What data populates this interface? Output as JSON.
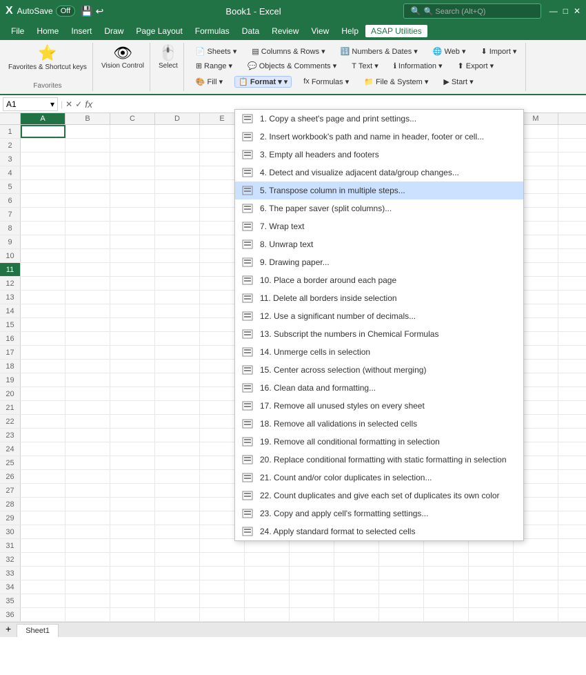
{
  "titlebar": {
    "logo": "X",
    "autosave_label": "AutoSave",
    "autosave_state": "Off",
    "save_icon": "💾",
    "title": "Book1  -  Excel",
    "search_placeholder": "🔍 Search (Alt+Q)"
  },
  "menubar": {
    "items": [
      "File",
      "Home",
      "Insert",
      "Draw",
      "Page Layout",
      "Formulas",
      "Data",
      "Review",
      "View",
      "Help",
      "ASAP Utilities"
    ]
  },
  "ribbon": {
    "favorites_label": "Favorites & Shortcut keys",
    "favorites_group": "Favorites",
    "vision_control_label": "Vision Control",
    "select_label": "Select",
    "sheets_label": "Sheets ▾",
    "range_label": "Range ▾",
    "fill_label": "Fill ▾",
    "columns_rows_label": "Columns & Rows ▾",
    "objects_comments_label": "Objects & Comments ▾",
    "format_label": "Format ▾",
    "text_label": "Text ▾",
    "numbers_dates_label": "Numbers & Dates ▾",
    "web_label": "Web ▾",
    "information_label": "Information ▾",
    "file_system_label": "File & System ▾",
    "import_label": "Import ▾",
    "export_label": "Export ▾",
    "formulas_label": "Formulas ▾",
    "start_label": "Start ▾"
  },
  "formula_bar": {
    "name_box": "A1",
    "fx_label": "fx"
  },
  "columns": [
    "A",
    "B",
    "C",
    "D",
    "E",
    "M"
  ],
  "rows": [
    1,
    2,
    3,
    4,
    5,
    6,
    7,
    8,
    9,
    10,
    11,
    12,
    13,
    14,
    15,
    16,
    17,
    18,
    19,
    20,
    21,
    22,
    23,
    24,
    25,
    26,
    27,
    28,
    29,
    30,
    31,
    32,
    33,
    34,
    35,
    36
  ],
  "dropdown": {
    "items": [
      {
        "num": "1.",
        "text": "Copy a sheet's page and print settings...",
        "icon": "📄"
      },
      {
        "num": "2.",
        "text": "Insert workbook's path and name in header, footer or cell...",
        "icon": "📋"
      },
      {
        "num": "3.",
        "text": "Empty all headers and footers",
        "icon": "📄"
      },
      {
        "num": "4.",
        "text": "Detect and visualize adjacent data/group changes...",
        "icon": "📊"
      },
      {
        "num": "5.",
        "text": "Transpose column in multiple steps...",
        "icon": "🔄",
        "highlighted": true
      },
      {
        "num": "6.",
        "text": "The paper saver (split columns)...",
        "icon": "📋"
      },
      {
        "num": "7.",
        "text": "Wrap text",
        "icon": "📝"
      },
      {
        "num": "8.",
        "text": "Unwrap text",
        "icon": "📝"
      },
      {
        "num": "9.",
        "text": "Drawing paper...",
        "icon": "📐"
      },
      {
        "num": "10.",
        "text": "Place a border around each page",
        "icon": "⬜"
      },
      {
        "num": "11.",
        "text": "Delete all borders inside selection",
        "icon": "⬜"
      },
      {
        "num": "12.",
        "text": "Use a significant number of decimals...",
        "icon": "🔢"
      },
      {
        "num": "13.",
        "text": "Subscript the numbers in Chemical Formulas",
        "icon": "X₂"
      },
      {
        "num": "14.",
        "text": "Unmerge cells in selection",
        "icon": "📋"
      },
      {
        "num": "15.",
        "text": "Center across selection (without merging)",
        "icon": "📋"
      },
      {
        "num": "16.",
        "text": "Clean data and formatting...",
        "icon": "✨"
      },
      {
        "num": "17.",
        "text": "Remove all unused styles on every sheet",
        "icon": "📋"
      },
      {
        "num": "18.",
        "text": "Remove all validations in selected cells",
        "icon": "📋"
      },
      {
        "num": "19.",
        "text": "Remove all conditional formatting in selection",
        "icon": "📋"
      },
      {
        "num": "20.",
        "text": "Replace conditional formatting with static formatting in selection",
        "icon": "📋"
      },
      {
        "num": "21.",
        "text": "Count and/or color duplicates in selection...",
        "icon": "📋"
      },
      {
        "num": "22.",
        "text": "Count duplicates and give each set of duplicates its own color",
        "icon": "📋"
      },
      {
        "num": "23.",
        "text": "Copy and apply cell's formatting settings...",
        "icon": "🖌️"
      },
      {
        "num": "24.",
        "text": "Apply standard format to selected cells",
        "icon": "📋"
      }
    ]
  }
}
